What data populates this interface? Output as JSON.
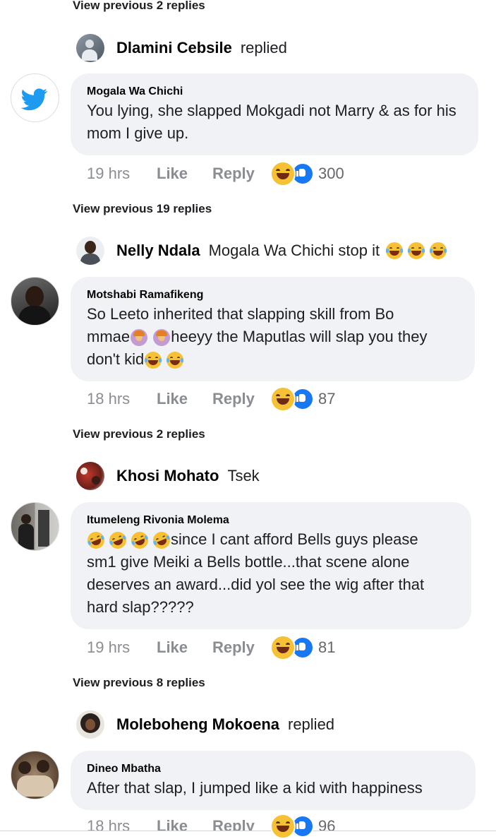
{
  "threads": [
    {
      "view_previous": "View previous 2 replies",
      "reply_name": "Dlamini Cebsile",
      "reply_text": "replied",
      "author": "Mogala Wa Chichi",
      "body": "You lying, she slapped Mokgadi not Marry & as for his mom I give up.",
      "time": "19 hrs",
      "like": "Like",
      "reply": "Reply",
      "count": "300"
    },
    {
      "view_previous": "View previous 19 replies",
      "reply_name": "Nelly Ndala",
      "reply_text": "Mogala Wa Chichi stop it",
      "author": "Motshabi Ramafikeng",
      "body_line1": "So Leeto inherited that slapping skill from Bo",
      "body_line2a": "mmae",
      "body_line2b": "heeyy the Maputlas will slap you they",
      "body_line3": "don't kid",
      "time": "18 hrs",
      "like": "Like",
      "reply": "Reply",
      "count": "87"
    },
    {
      "view_previous": "View previous 2 replies",
      "reply_name": "Khosi Mohato",
      "reply_text": "Tsek",
      "author": "Itumeleng Rivonia Molema",
      "body_line1": "since I cant afford Bells guys please",
      "body_rest": "sm1 give  Meiki a Bells bottle...that scene alone deserves an award...did yol see the wig after that hard slap?????",
      "time": "19 hrs",
      "like": "Like",
      "reply": "Reply",
      "count": "81"
    },
    {
      "view_previous": "View previous 8 replies",
      "reply_name": "Moleboheng Mokoena",
      "reply_text": "replied",
      "author": "Dineo Mbatha",
      "body": "After that slap, I jumped like a kid with happiness",
      "time": "18 hrs",
      "like": "Like",
      "reply": "Reply",
      "count": "96"
    }
  ],
  "colors": {
    "bubble": "#f0f2f5",
    "meta": "#8a8d91",
    "twitter": "#1d9bf0",
    "like_blue": "#1877f2"
  }
}
